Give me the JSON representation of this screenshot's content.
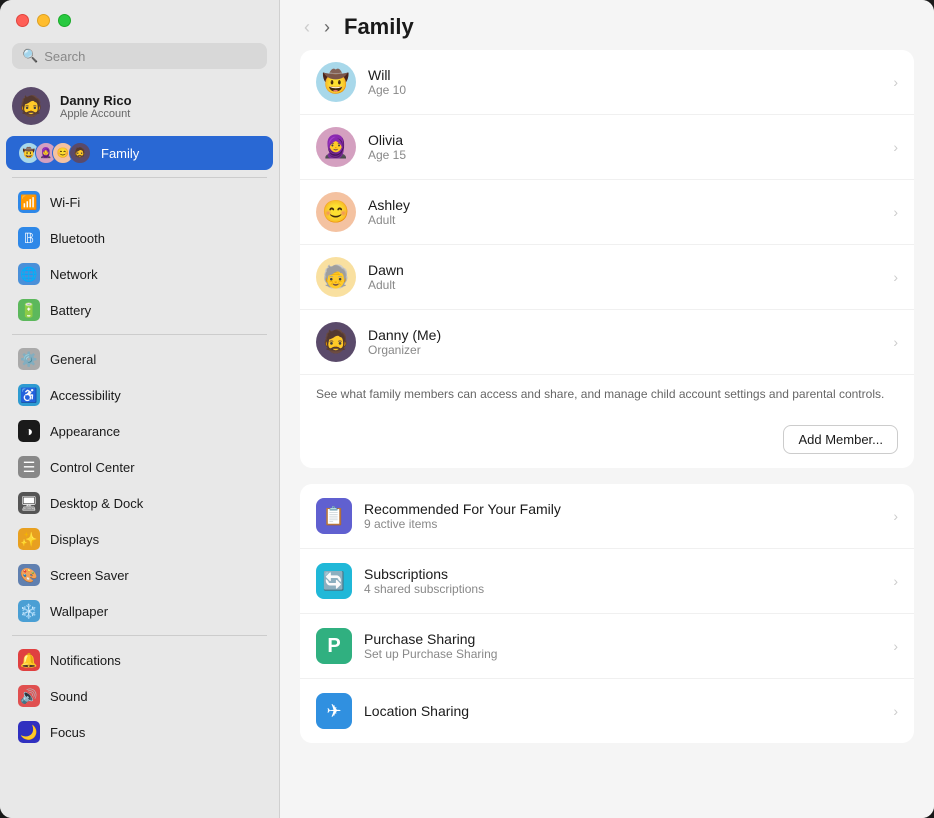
{
  "window": {
    "title": "Family"
  },
  "sidebar": {
    "search_placeholder": "Search",
    "account": {
      "name": "Danny Rico",
      "subtitle": "Apple Account"
    },
    "items": [
      {
        "id": "family",
        "label": "Family",
        "icon": "👨‍👩‍👧‍👦",
        "active": true
      },
      {
        "id": "wifi",
        "label": "Wi-Fi",
        "icon": "📶",
        "bg": "ic-wifi"
      },
      {
        "id": "bluetooth",
        "label": "Bluetooth",
        "icon": "🔵",
        "bg": "ic-bt"
      },
      {
        "id": "network",
        "label": "Network",
        "icon": "🌐",
        "bg": "ic-net"
      },
      {
        "id": "battery",
        "label": "Battery",
        "icon": "🔋",
        "bg": "ic-bat"
      },
      {
        "id": "general",
        "label": "General",
        "icon": "⚙️",
        "bg": "ic-gen"
      },
      {
        "id": "accessibility",
        "label": "Accessibility",
        "icon": "♿",
        "bg": "ic-acc"
      },
      {
        "id": "appearance",
        "label": "Appearance",
        "icon": "◑",
        "bg": "ic-app"
      },
      {
        "id": "control-center",
        "label": "Control Center",
        "icon": "☰",
        "bg": "ic-cc"
      },
      {
        "id": "desktop-dock",
        "label": "Desktop & Dock",
        "icon": "🖥",
        "bg": "ic-dd"
      },
      {
        "id": "displays",
        "label": "Displays",
        "icon": "✨",
        "bg": "ic-disp"
      },
      {
        "id": "screen-saver",
        "label": "Screen Saver",
        "icon": "🎨",
        "bg": "ic-ss"
      },
      {
        "id": "wallpaper",
        "label": "Wallpaper",
        "icon": "❄️",
        "bg": "ic-wall"
      },
      {
        "id": "notifications",
        "label": "Notifications",
        "icon": "🔔",
        "bg": "ic-notif"
      },
      {
        "id": "sound",
        "label": "Sound",
        "icon": "🔊",
        "bg": "ic-sound"
      },
      {
        "id": "focus",
        "label": "Focus",
        "icon": "🌙",
        "bg": "ic-focus"
      }
    ]
  },
  "main": {
    "title": "Family",
    "members": [
      {
        "name": "Will",
        "role": "Age 10",
        "emoji": "🤠",
        "bg": "av-will"
      },
      {
        "name": "Olivia",
        "role": "Age 15",
        "emoji": "🧕",
        "bg": "av-olivia"
      },
      {
        "name": "Ashley",
        "role": "Adult",
        "emoji": "😊",
        "bg": "av-ashley"
      },
      {
        "name": "Dawn",
        "role": "Adult",
        "emoji": "🧓",
        "bg": "av-dawn"
      },
      {
        "name": "Danny (Me)",
        "role": "Organizer",
        "emoji": "🧔",
        "bg": "av-danny"
      }
    ],
    "description": "See what family members can access and share, and manage child account settings and parental controls.",
    "add_member_label": "Add Member...",
    "services": [
      {
        "id": "recommended",
        "name": "Recommended For Your Family",
        "sub": "9 active items",
        "icon": "📋",
        "bg": "svc-rec"
      },
      {
        "id": "subscriptions",
        "name": "Subscriptions",
        "sub": "4 shared subscriptions",
        "icon": "🔄",
        "bg": "svc-sub"
      },
      {
        "id": "purchase-sharing",
        "name": "Purchase Sharing",
        "sub": "Set up Purchase Sharing",
        "icon": "🅿",
        "bg": "svc-pur"
      },
      {
        "id": "location-sharing",
        "name": "Location Sharing",
        "sub": "",
        "icon": "✈",
        "bg": "svc-loc"
      }
    ]
  }
}
